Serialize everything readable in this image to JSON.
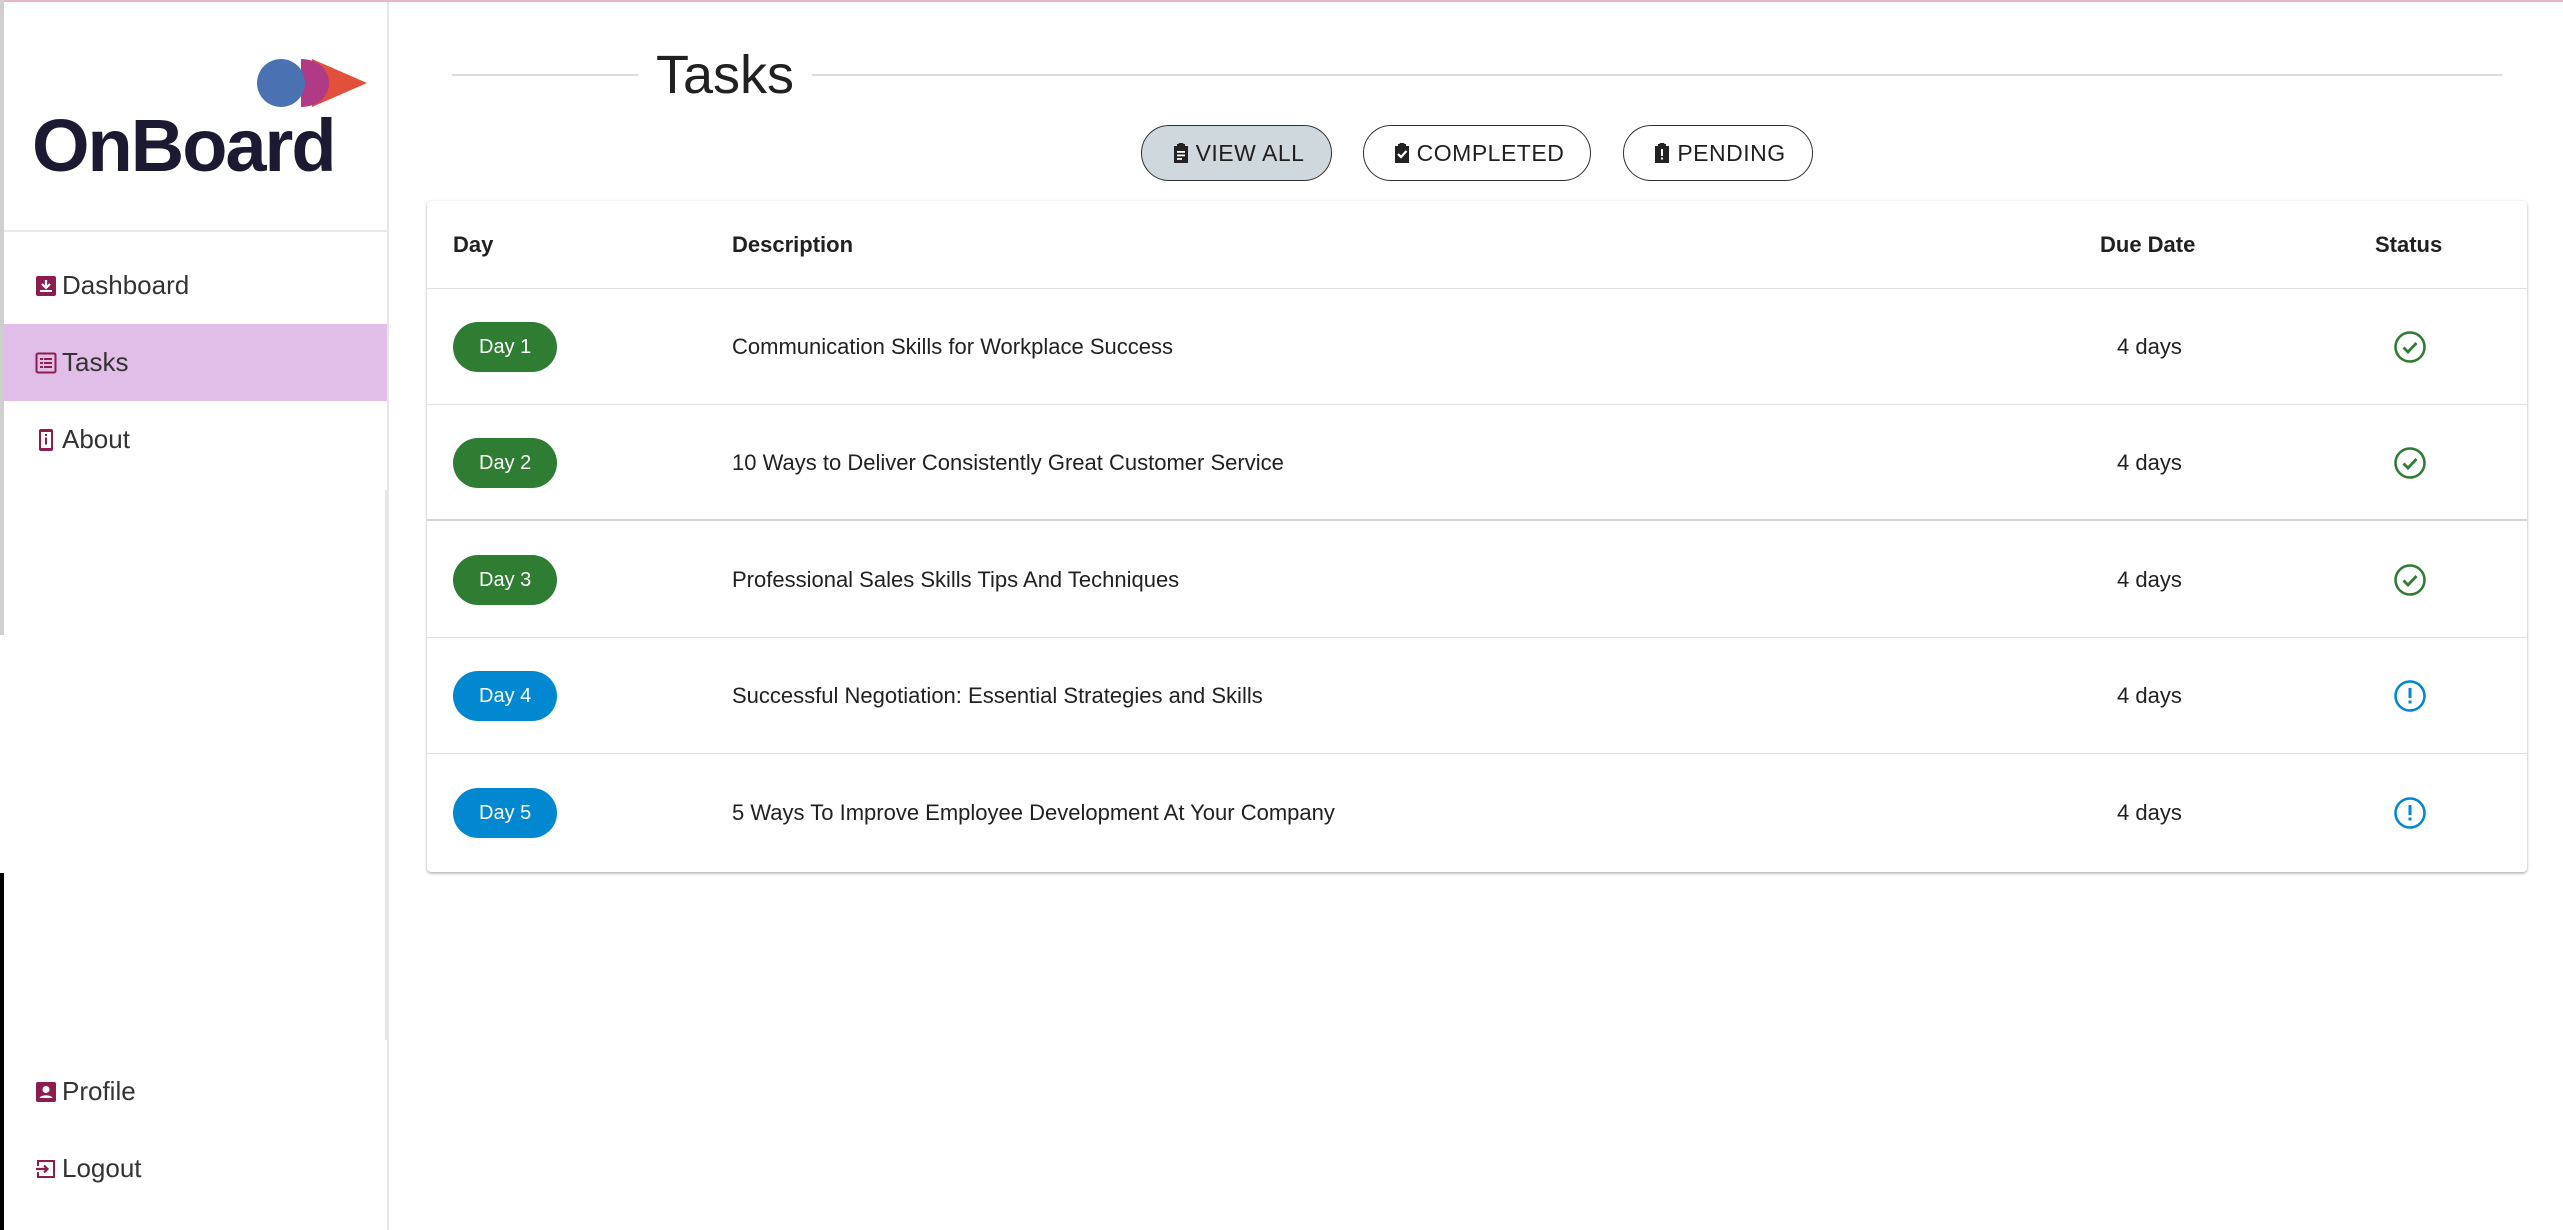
{
  "app": {
    "logo_text": "OnBoard",
    "colors": {
      "brand_primary": "#8e1d4f",
      "nav_active_bg": "#e1bee7",
      "completed": "#2e7d32",
      "pending": "#0288d1",
      "filter_selected_bg": "#cfd8dc",
      "logo_circle_blue": "#4a72b3",
      "logo_shape_magenta": "#b03a86",
      "logo_triangle_orange": "#e24f3b"
    }
  },
  "sidebar": {
    "items": [
      {
        "label": "Dashboard",
        "icon": "dashboard-icon",
        "active": false
      },
      {
        "label": "Tasks",
        "icon": "task-list-icon",
        "active": true
      },
      {
        "label": "About",
        "icon": "phone-info-icon",
        "active": false
      }
    ],
    "bottom_items": [
      {
        "label": "Profile",
        "icon": "profile-icon"
      },
      {
        "label": "Logout",
        "icon": "logout-icon"
      }
    ]
  },
  "page": {
    "title": "Tasks"
  },
  "filters": {
    "view_all": "VIEW ALL",
    "completed": "COMPLETED",
    "pending": "PENDING",
    "selected": "view_all"
  },
  "table": {
    "headers": {
      "day": "Day",
      "description": "Description",
      "due_date": "Due Date",
      "status": "Status"
    },
    "rows": [
      {
        "day": "Day 1",
        "description": "Communication Skills for Workplace Success",
        "due": "4 days",
        "status": "completed"
      },
      {
        "day": "Day 2",
        "description": "10 Ways to Deliver Consistently Great Customer Service",
        "due": "4 days",
        "status": "completed"
      },
      {
        "day": "Day 3",
        "description": "Professional Sales Skills Tips And Techniques",
        "due": "4 days",
        "status": "completed"
      },
      {
        "day": "Day 4",
        "description": "Successful Negotiation: Essential Strategies and Skills",
        "due": "4 days",
        "status": "pending"
      },
      {
        "day": "Day 5",
        "description": "5 Ways To Improve Employee Development At Your Company",
        "due": "4 days",
        "status": "pending"
      }
    ]
  }
}
